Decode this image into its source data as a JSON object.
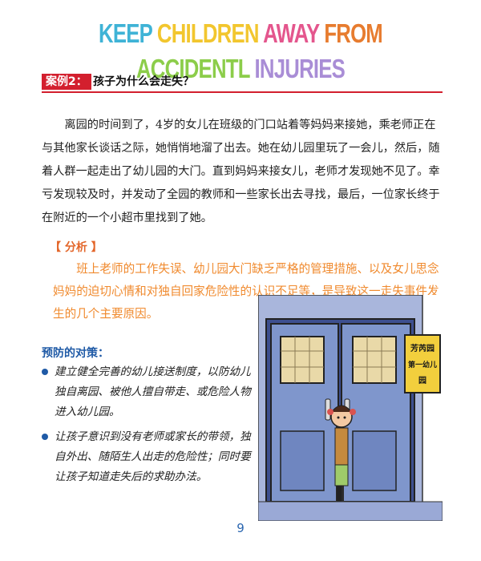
{
  "banner": {
    "words": [
      {
        "text": "KEEP ",
        "color": "#3fb3d6"
      },
      {
        "text": "CHILDREN ",
        "color": "#f2c62e"
      },
      {
        "text": "AWAY ",
        "color": "#e4568d"
      },
      {
        "text": "FROM ",
        "color": "#e77c2f"
      },
      {
        "text": "ACCIDENTL ",
        "color": "#8ccd4a"
      },
      {
        "text": "INJURIES",
        "color": "#a98dd6"
      }
    ]
  },
  "case": {
    "tag": "案例2：",
    "title": "孩子为什么会走失？"
  },
  "story": "离园的时间到了，4岁的女儿在班级的门口站着等妈妈来接她，乘老师正在与其他家长谈话之际，她悄悄地溜了出去。她在幼儿园里玩了一会儿，然后，随着人群一起走出了幼儿园的大门。直到妈妈来接女儿，老师才发现她不见了。幸亏发现较及时，并发动了全园的教师和一些家长出去寻找，最后，一位家长终于在附近的一个小超市里找到了她。",
  "analysis": {
    "heading": "【 分析 】",
    "text": "班上老师的工作失误、幼儿园大门缺乏严格的管理措施、以及女儿思念妈妈的迫切心情和对独自回家危险性的认识不足等，是导致这一走失事件发生的几个主要原因。"
  },
  "prevention": {
    "heading": "预防的对策：",
    "items": [
      "建立健全完善的幼儿接送制度，以防幼儿独自离园、被他人擅自带走、或危险人物进入幼儿园。",
      "让孩子意识到没有老师或家长的带领，独自外出、随陌生人出走的危险性；同时要让孩子知道走失后的求助办法。"
    ]
  },
  "sign": {
    "lines": [
      "芳芮园",
      "第一幼儿",
      "园"
    ]
  },
  "page_number": "9",
  "colors": {
    "accent_red": "#d31f2e",
    "analysis_orange": "#f08a2e",
    "heading_blue": "#1f5aa6",
    "door_blue": "#7f96cc"
  }
}
